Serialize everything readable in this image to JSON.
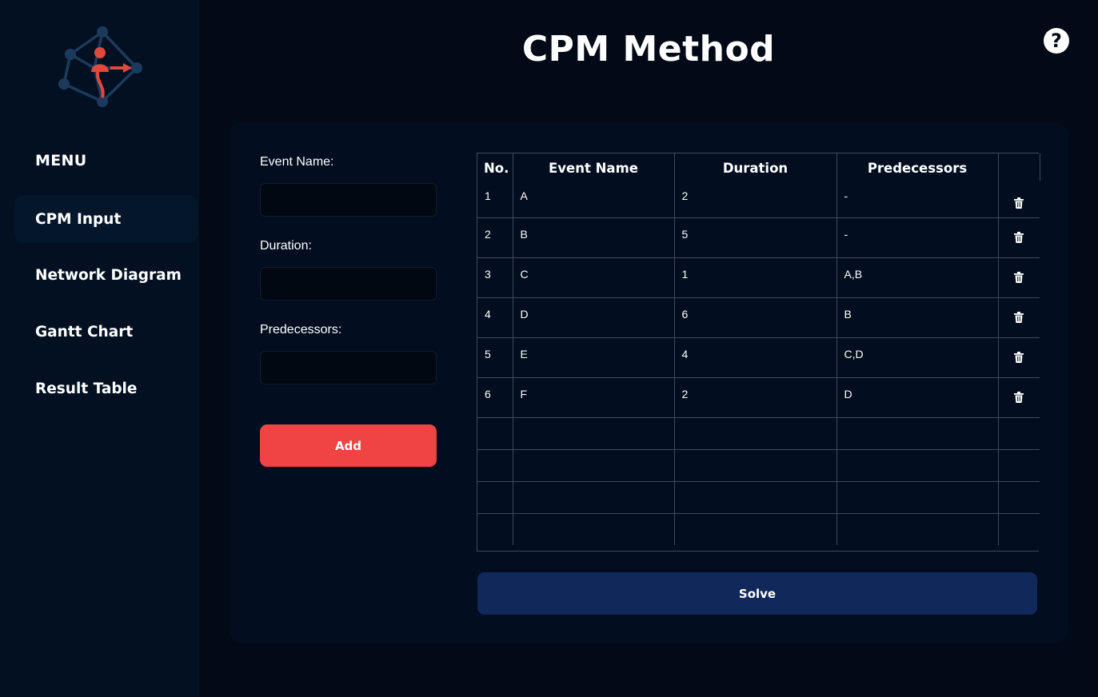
{
  "sidebar": {
    "menu_title": "MENU",
    "items": [
      {
        "label": "CPM Input",
        "active": true
      },
      {
        "label": "Network Diagram",
        "active": false
      },
      {
        "label": "Gantt Chart",
        "active": false
      },
      {
        "label": "Result Table",
        "active": false
      }
    ]
  },
  "header": {
    "title": "CPM Method",
    "help_icon": "help-circle-icon"
  },
  "form": {
    "event_name_label": "Event Name:",
    "event_name_value": "",
    "duration_label": "Duration:",
    "duration_value": "",
    "predecessors_label": "Predecessors:",
    "predecessors_value": "",
    "add_label": "Add"
  },
  "table": {
    "columns": [
      "No.",
      "Event Name",
      "Duration",
      "Predecessors",
      ""
    ],
    "rows": [
      {
        "no": "1",
        "event": "A",
        "duration": "2",
        "predecessors": "-"
      },
      {
        "no": "2",
        "event": "B",
        "duration": "5",
        "predecessors": "-"
      },
      {
        "no": "3",
        "event": "C",
        "duration": "1",
        "predecessors": "A,B"
      },
      {
        "no": "4",
        "event": "D",
        "duration": "6",
        "predecessors": "B"
      },
      {
        "no": "5",
        "event": "E",
        "duration": "4",
        "predecessors": "C,D"
      },
      {
        "no": "6",
        "event": "F",
        "duration": "2",
        "predecessors": "D"
      }
    ],
    "delete_icon": "trash-icon"
  },
  "solve_label": "Solve",
  "colors": {
    "background": "#010a16",
    "sidebar": "#021022",
    "card": "#020e1f",
    "add_button": "#ef4444",
    "solve_button": "#10285a",
    "logo_accent": "#e0493c",
    "logo_network": "#1d3a5c"
  }
}
